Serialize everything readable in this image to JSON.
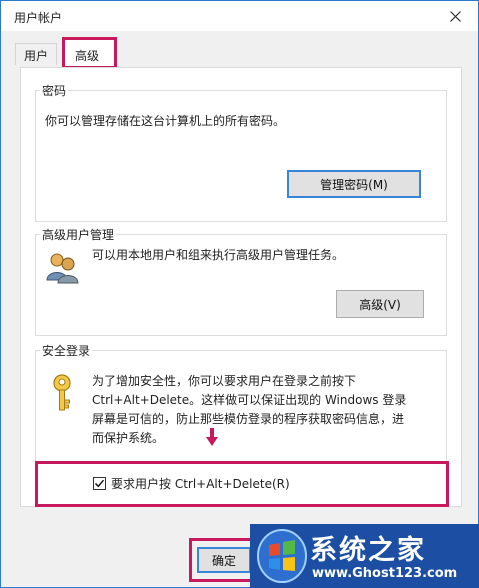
{
  "window": {
    "title": "用户帐户"
  },
  "tabs": [
    {
      "label": "用户"
    },
    {
      "label": "高级"
    }
  ],
  "password_group": {
    "title": "密码",
    "description": "你可以管理存储在这台计算机上的所有密码。",
    "button_label": "管理密码(M)"
  },
  "user_mgmt_group": {
    "title": "高级用户管理",
    "description": "可以用本地用户和组来执行高级用户管理任务。",
    "button_label": "高级(V)"
  },
  "secure_logon_group": {
    "title": "安全登录",
    "description": "为了增加安全性，你可以要求用户在登录之前按下 Ctrl+Alt+Delete。这样做可以保证出现的 Windows 登录屏幕是可信的，防止那些模仿登录的程序获取密码信息，进而保护系统。"
  },
  "require_ctrl_alt_del": {
    "label": "要求用户按 Ctrl+Alt+Delete(R)",
    "checked": true
  },
  "footer": {
    "ok_label": "确定"
  },
  "watermark": {
    "title": "系统之家",
    "url": "www.Ghost123.com"
  },
  "colors": {
    "highlight": "#c8195f",
    "focus_border": "#3a86d6",
    "watermark_bg": "#1c4fa3"
  },
  "icons": [
    "close-icon",
    "users-icon",
    "key-icon",
    "arrow-down-icon",
    "checkmark-icon",
    "windows-logo-icon"
  ]
}
